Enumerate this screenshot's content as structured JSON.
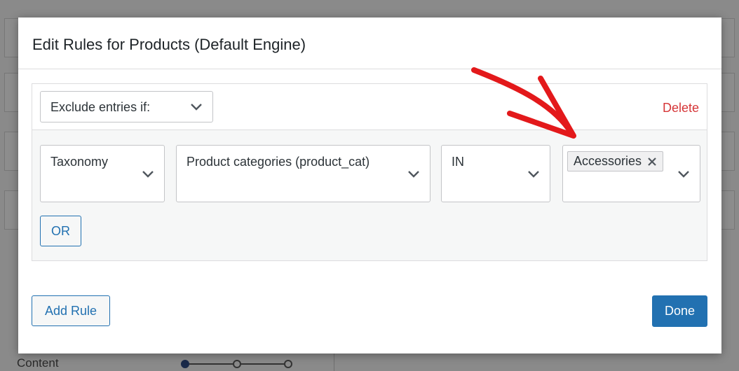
{
  "modal": {
    "title": "Edit Rules for Products (Default Engine)"
  },
  "rule": {
    "mode_label": "Exclude entries if:",
    "delete_label": "Delete",
    "condition": {
      "taxonomy": "Taxonomy",
      "field": "Product categories (product_cat)",
      "operator": "IN",
      "values": [
        "Accessories"
      ]
    },
    "or_label": "OR"
  },
  "footer": {
    "add_rule_label": "Add Rule",
    "done_label": "Done"
  },
  "background": {
    "content_label": "Content"
  },
  "colors": {
    "accent": "#2271b1",
    "delete": "#d63638",
    "annotation_arrow": "#e3191b"
  },
  "icons": {
    "dropdown": "chevron-down-icon",
    "remove_tag": "close-icon",
    "annotation": "red-arrow-icon"
  }
}
